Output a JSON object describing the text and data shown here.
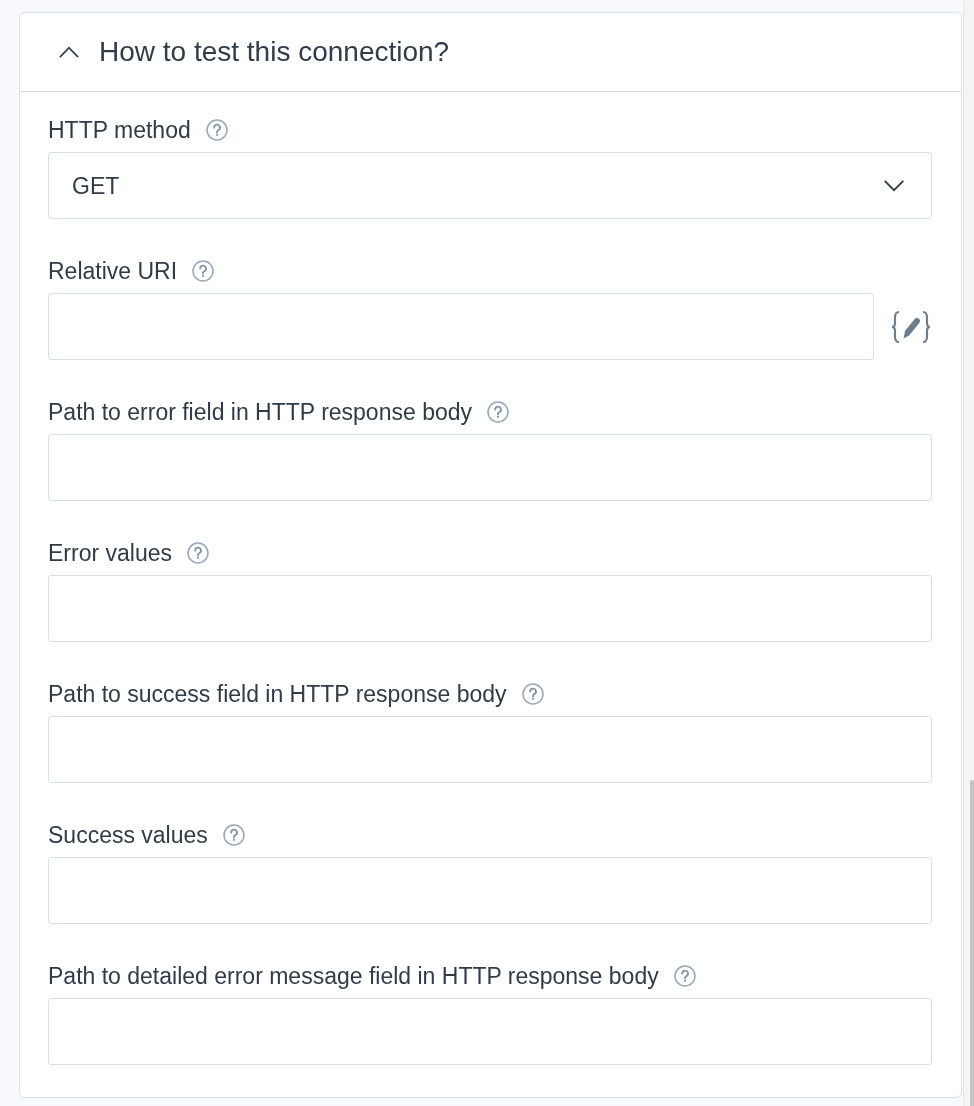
{
  "section": {
    "title": "How to test this connection?",
    "expanded": true
  },
  "fields": [
    {
      "kind": "select",
      "label": "HTTP method",
      "value": "GET"
    },
    {
      "kind": "template",
      "label": "Relative URI"
    },
    {
      "kind": "text",
      "label": "Path to error field in HTTP response body"
    },
    {
      "kind": "text",
      "label": "Error values"
    },
    {
      "kind": "text",
      "label": "Path to success field in HTTP response body"
    },
    {
      "kind": "text",
      "label": "Success values"
    },
    {
      "kind": "text",
      "label": "Path to detailed error message field in HTTP response body"
    }
  ]
}
